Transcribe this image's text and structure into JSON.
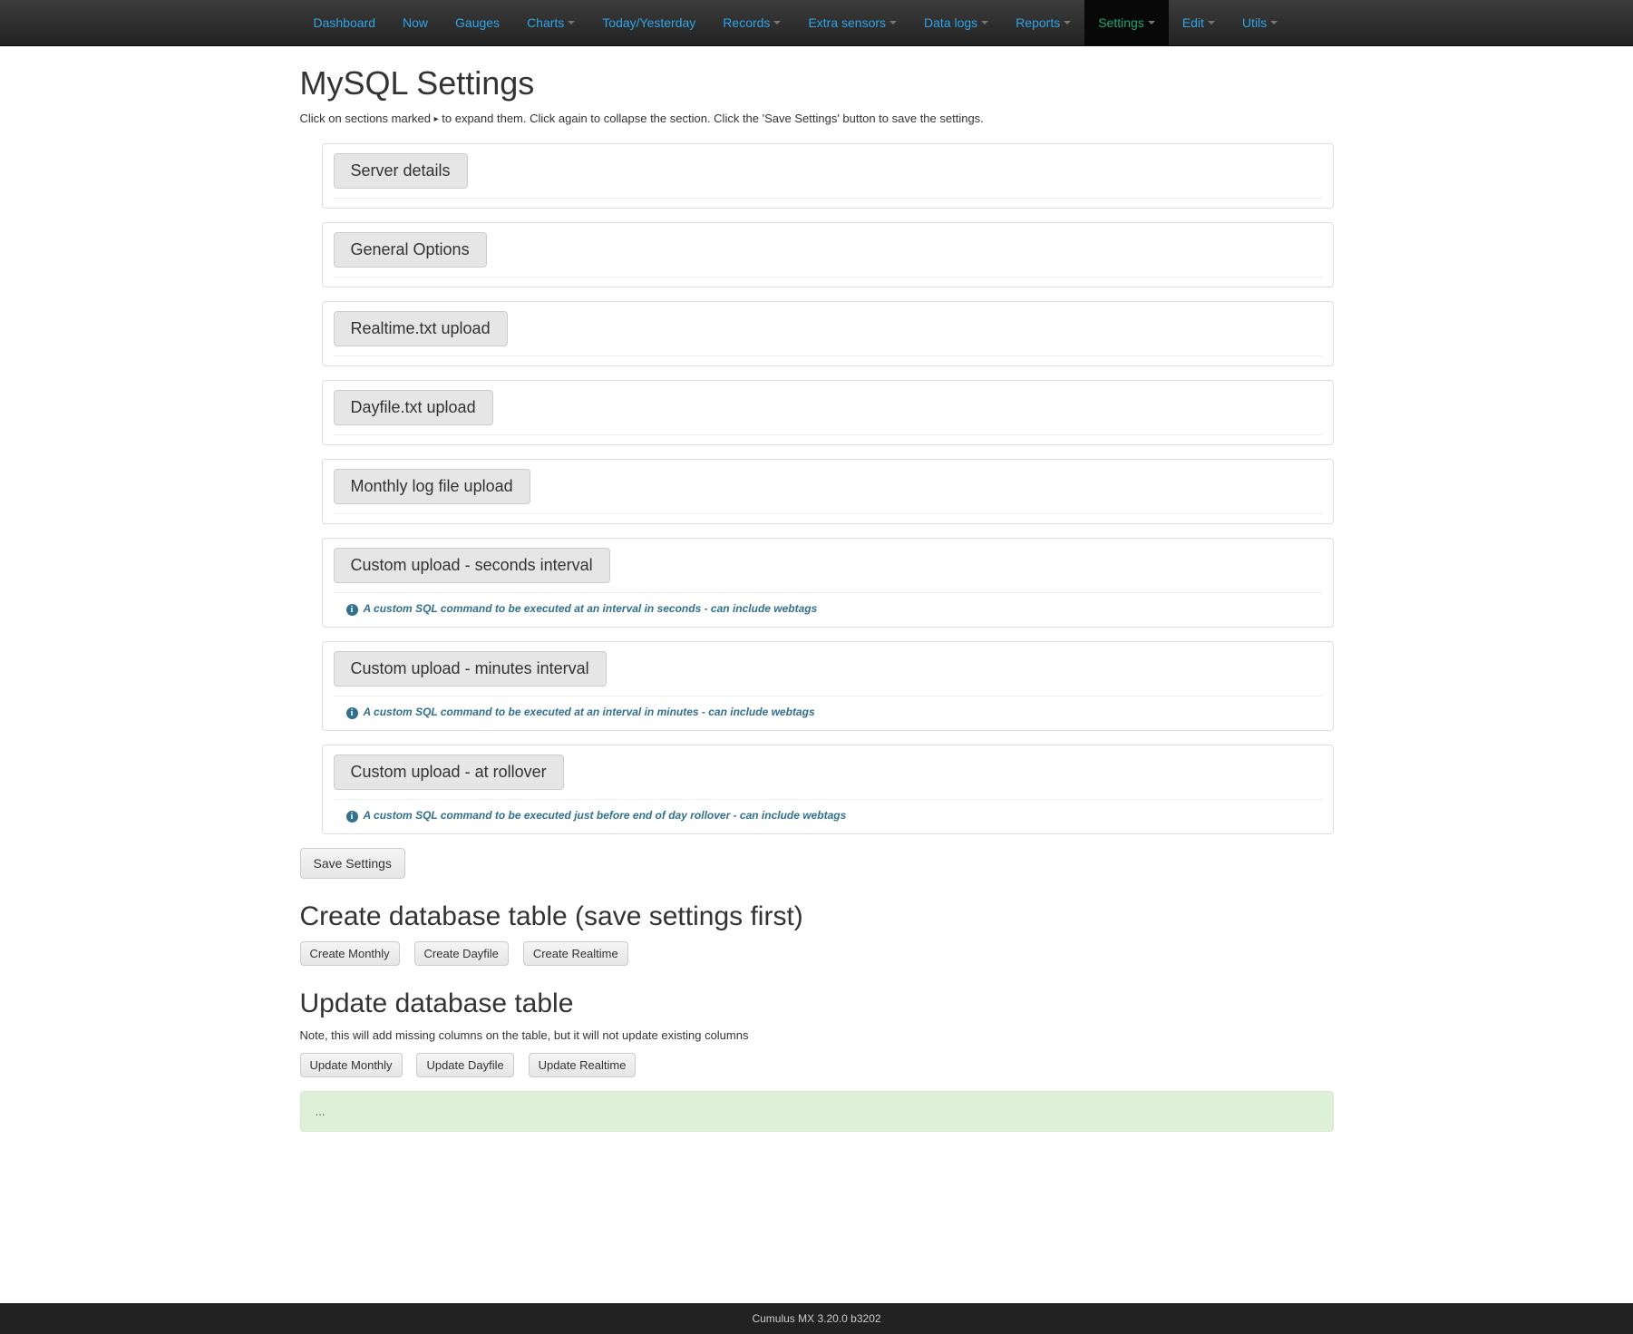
{
  "nav": {
    "items": [
      {
        "label": "Dashboard",
        "dropdown": false,
        "active": false
      },
      {
        "label": "Now",
        "dropdown": false,
        "active": false
      },
      {
        "label": "Gauges",
        "dropdown": false,
        "active": false
      },
      {
        "label": "Charts",
        "dropdown": true,
        "active": false
      },
      {
        "label": "Today/Yesterday",
        "dropdown": false,
        "active": false
      },
      {
        "label": "Records",
        "dropdown": true,
        "active": false
      },
      {
        "label": "Extra sensors",
        "dropdown": true,
        "active": false
      },
      {
        "label": "Data logs",
        "dropdown": true,
        "active": false
      },
      {
        "label": "Reports",
        "dropdown": true,
        "active": false
      },
      {
        "label": "Settings",
        "dropdown": true,
        "active": true
      },
      {
        "label": "Edit",
        "dropdown": true,
        "active": false
      },
      {
        "label": "Utils",
        "dropdown": true,
        "active": false
      }
    ]
  },
  "page": {
    "title": "MySQL Settings",
    "help_pre": "Click on sections marked ",
    "help_marker": "▸",
    "help_post": " to expand them. Click again to collapse the section. Click the 'Save Settings' button to save the settings."
  },
  "sections": [
    {
      "legend": "Server details",
      "info": null
    },
    {
      "legend": "General Options",
      "info": null
    },
    {
      "legend": "Realtime.txt upload",
      "info": null
    },
    {
      "legend": "Dayfile.txt upload",
      "info": null
    },
    {
      "legend": "Monthly log file upload",
      "info": null
    },
    {
      "legend": "Custom upload - seconds interval",
      "info": "A custom SQL command to be executed at an interval in seconds - can include webtags"
    },
    {
      "legend": "Custom upload - minutes interval",
      "info": "A custom SQL command to be executed at an interval in minutes - can include webtags"
    },
    {
      "legend": "Custom upload - at rollover",
      "info": "A custom SQL command to be executed just before end of day rollover - can include webtags"
    }
  ],
  "buttons": {
    "save": "Save Settings",
    "create_heading": "Create database table (save settings first)",
    "create_monthly": "Create Monthly",
    "create_dayfile": "Create Dayfile",
    "create_realtime": "Create Realtime",
    "update_heading": "Update database table",
    "update_note": "Note, this will add missing columns on the table, but it will not update existing columns",
    "update_monthly": "Update Monthly",
    "update_dayfile": "Update Dayfile",
    "update_realtime": "Update Realtime"
  },
  "status": {
    "message": "..."
  },
  "footer": {
    "text": "Cumulus MX 3.20.0 b3202"
  }
}
